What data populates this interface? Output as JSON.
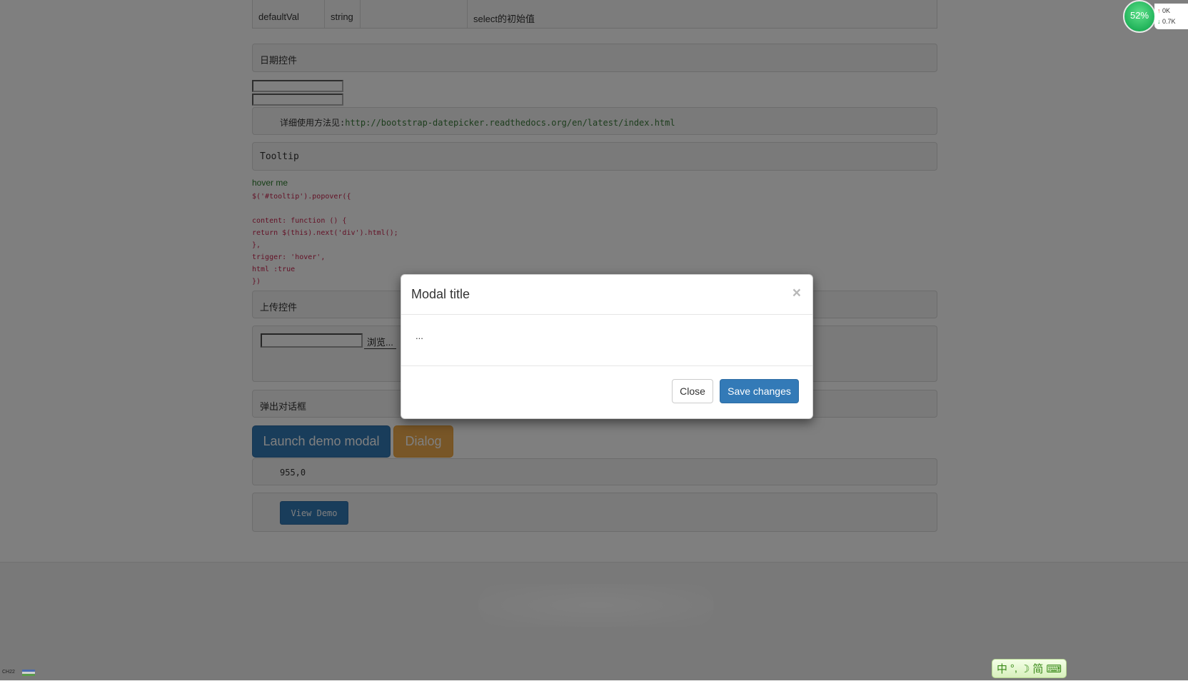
{
  "table": {
    "row": [
      "defaultVal",
      "string",
      "",
      "select的初始值"
    ]
  },
  "date_section": {
    "title": "日期控件",
    "doc_prefix": "详细使用方法见:",
    "doc_link": "http://bootstrap-datepicker.readthedocs.org/en/latest/index.html"
  },
  "tooltip_section": {
    "title": "Tooltip",
    "hover_link": "hover me",
    "code": [
      "$('#tooltip').popover({",
      "",
      "content: function () {",
      "return $(this).next('div').html();",
      "},",
      "trigger: 'hover',",
      "html :true",
      "})"
    ]
  },
  "upload_section": {
    "title": "上传控件",
    "browse_label": "浏览..."
  },
  "dialog_section": {
    "title": "弹出对话框",
    "launch_label": "Launch demo modal",
    "dialog_label": "Dialog",
    "coords": "955,0",
    "view_demo_label": "View Demo"
  },
  "modal": {
    "title": "Modal title",
    "close_icon": "×",
    "body": "...",
    "close_label": "Close",
    "save_label": "Save changes"
  },
  "net_widget": {
    "percent": "52%",
    "up": "0K",
    "down": "0.7K"
  },
  "ime": {
    "items": [
      "中",
      "°,",
      "☽",
      "简",
      "⌨"
    ]
  },
  "taskbar": {
    "lang": "CH22"
  },
  "colors": {
    "primary": "#337ab7",
    "warning": "#f0ad4e",
    "link_green": "#3a7a3a",
    "code_red": "#c7254e"
  }
}
